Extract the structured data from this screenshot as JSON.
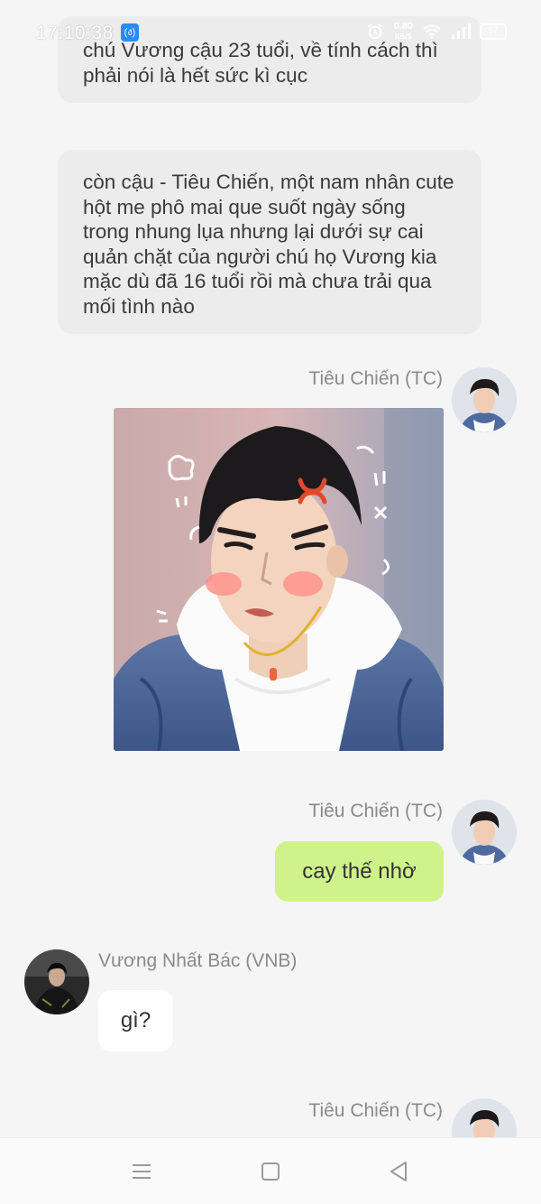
{
  "status_bar": {
    "time": "17:10:38",
    "notification_badge": "(ง)",
    "network_speed_value": "0.80",
    "network_speed_unit": "KB/S",
    "battery": "57"
  },
  "messages": {
    "narration_1": "chú Vương cậu 23 tuổi, về tính cách thì phải nói là hết sức kì cục",
    "narration_2": "còn cậu - Tiêu Chiến, một nam nhân cute hột me phô mai que suốt ngày sống trong nhung lụa nhưng lại dưới sự cai quản chặt của người chú họ Vương kia mặc dù đã 16 tuổi rồi mà chưa trải qua mối tình nào",
    "sender_tc_1": "Tiêu Chiến (TC)",
    "sender_tc_2": "Tiêu Chiến (TC)",
    "reply_tc": "cay thế nhờ",
    "sender_vnb": "Vương Nhất Bác (VNB)",
    "reply_vnb": "gì?",
    "sender_tc_3": "Tiêu Chiến (TC)"
  },
  "colors": {
    "background": "#f5f5f5",
    "narration_bubble": "#ececec",
    "sent_bubble": "#d0f28a",
    "received_bubble": "#ffffff",
    "sender_name": "#8a8a8a"
  },
  "icons": {
    "nav_menu": "menu-icon",
    "nav_home": "home-square-icon",
    "nav_back": "back-triangle-icon"
  }
}
